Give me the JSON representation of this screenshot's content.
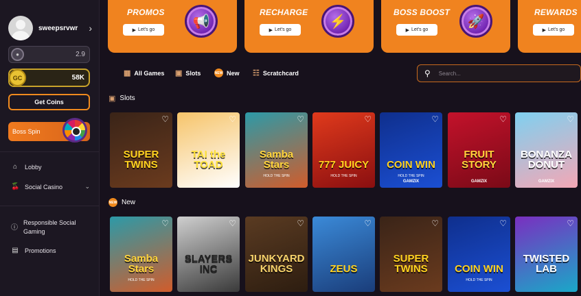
{
  "sidebar": {
    "username": "sweepsrvwr",
    "sc_balance": "2.9",
    "gc_label": "GC",
    "gc_balance": "58K",
    "get_coins_label": "Get Coins",
    "boss_spin_label": "Boss Spin",
    "nav": [
      {
        "label": "Lobby",
        "icon": "home-icon"
      },
      {
        "label": "Social Casino",
        "icon": "cherries-icon"
      },
      {
        "label": "Responsible Social Gaming",
        "icon": "info-icon"
      },
      {
        "label": "Promotions",
        "icon": "chart-icon"
      }
    ]
  },
  "promos": [
    {
      "title": "PROMOS",
      "button": "Let's go",
      "icon": "megaphone-icon"
    },
    {
      "title": "RECHARGE",
      "button": "Let's go",
      "icon": "lightning-icon"
    },
    {
      "title": "BOSS BOOST",
      "button": "Let's go",
      "icon": "rocket-icon"
    },
    {
      "title": "REWARDS",
      "button": "Let's go",
      "icon": "gift-icon"
    }
  ],
  "tabs": [
    {
      "label": "All Games",
      "icon": "grid-icon"
    },
    {
      "label": "Slots",
      "icon": "slot-machine-icon"
    },
    {
      "label": "New",
      "icon": "new-badge-icon",
      "badge": "NEW"
    },
    {
      "label": "Scratchcard",
      "icon": "scratchcard-icon"
    }
  ],
  "search": {
    "placeholder": "Search..."
  },
  "sections": {
    "slots": "Slots",
    "new": "New"
  },
  "slots_games": [
    {
      "title": "SUPER TWINS",
      "subtitle": "",
      "brand": "",
      "colors": [
        "#3a2418",
        "#6b3b1e"
      ],
      "text_color": "#ffd21f"
    },
    {
      "title": "TAI the TOAD",
      "subtitle": "",
      "brand": "",
      "colors": [
        "#f6c46a",
        "#ffffff"
      ],
      "text_color": "#ffe23a"
    },
    {
      "title": "Samba Stars",
      "subtitle": "HOLD THE SPIN",
      "brand": "",
      "colors": [
        "#2c9aa8",
        "#d15c2b"
      ],
      "text_color": "#ffd43b"
    },
    {
      "title": "777 JUICY",
      "subtitle": "HOLD THE SPIN",
      "brand": "",
      "colors": [
        "#e03a1c",
        "#8a0f10"
      ],
      "text_color": "#ffd21f"
    },
    {
      "title": "COIN WIN",
      "subtitle": "HOLD THE SPIN",
      "brand": "GAMZIX",
      "colors": [
        "#0f2f8d",
        "#1b4fd3"
      ],
      "text_color": "#ffd21f"
    },
    {
      "title": "FRUIT STORY",
      "subtitle": "",
      "brand": "GAMZIX",
      "colors": [
        "#c3122b",
        "#7a0a17"
      ],
      "text_color": "#ffd43b"
    },
    {
      "title": "BONANZA DONUT",
      "subtitle": "",
      "brand": "GAMZIX",
      "colors": [
        "#7fd0f0",
        "#f4a7b5"
      ],
      "text_color": "#ffffff"
    }
  ],
  "new_games": [
    {
      "title": "Samba Stars",
      "subtitle": "HOLD THE SPIN",
      "brand": "",
      "colors": [
        "#2c9aa8",
        "#d15c2b"
      ],
      "text_color": "#ffd43b"
    },
    {
      "title": "SLAYERS INC",
      "subtitle": "",
      "brand": "",
      "colors": [
        "#cfcfcf",
        "#3a3a3a"
      ],
      "text_color": "#222222"
    },
    {
      "title": "JUNKYARD KINGS",
      "subtitle": "",
      "brand": "",
      "colors": [
        "#5a3b22",
        "#2d1d10"
      ],
      "text_color": "#f7d36b"
    },
    {
      "title": "ZEUS",
      "subtitle": "",
      "brand": "",
      "colors": [
        "#3b8ad8",
        "#1a3d7a"
      ],
      "text_color": "#ffd21f"
    },
    {
      "title": "SUPER TWINS",
      "subtitle": "",
      "brand": "",
      "colors": [
        "#3a2418",
        "#6b3b1e"
      ],
      "text_color": "#ffd21f"
    },
    {
      "title": "COIN WIN",
      "subtitle": "HOLD THE SPIN",
      "brand": "",
      "colors": [
        "#0f2f8d",
        "#1b4fd3"
      ],
      "text_color": "#ffd21f"
    },
    {
      "title": "TWISTED LAB",
      "subtitle": "",
      "brand": "",
      "colors": [
        "#7a2fc0",
        "#1aa8c8"
      ],
      "text_color": "#ffffff"
    }
  ]
}
